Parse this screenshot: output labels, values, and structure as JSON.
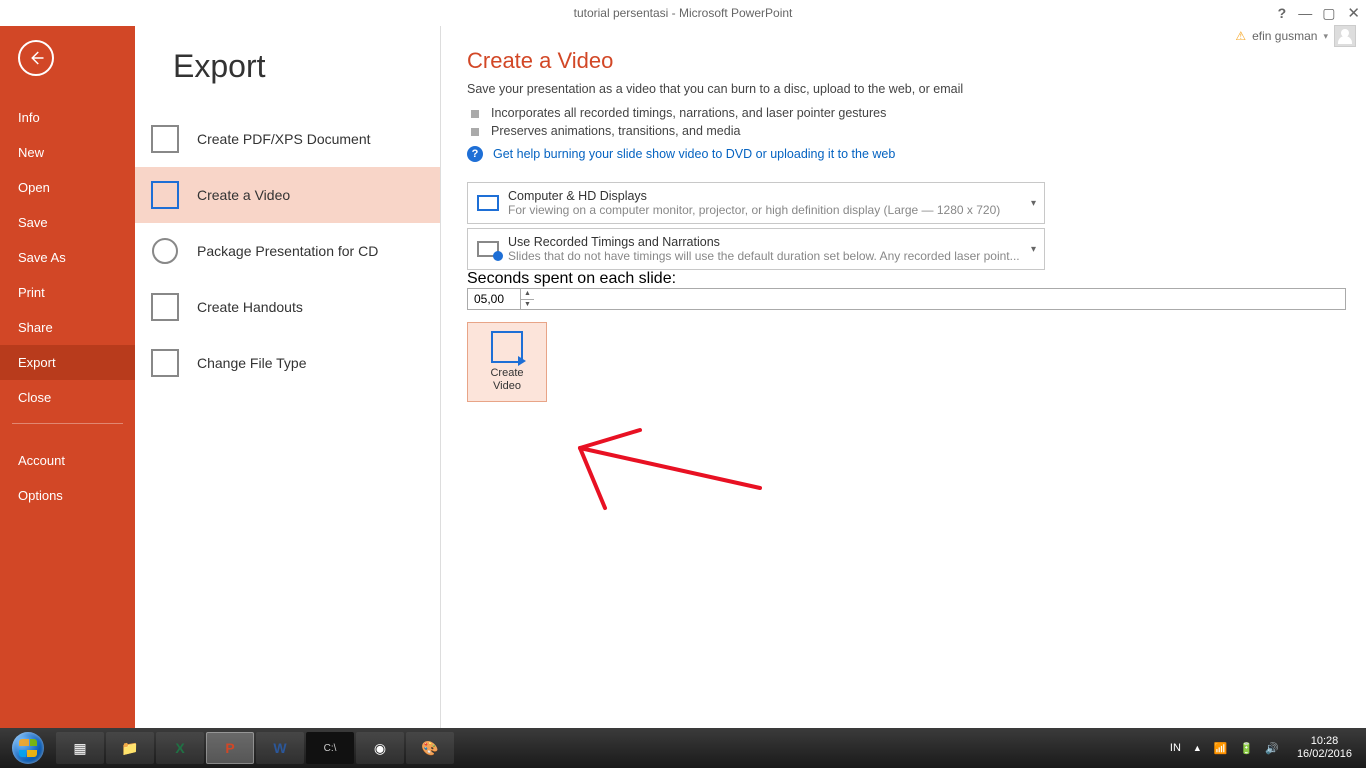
{
  "window": {
    "title": "tutorial persentasi - Microsoft PowerPoint",
    "user": "efin gusman"
  },
  "sidebar": {
    "items": [
      {
        "label": "Info"
      },
      {
        "label": "New"
      },
      {
        "label": "Open"
      },
      {
        "label": "Save"
      },
      {
        "label": "Save As"
      },
      {
        "label": "Print"
      },
      {
        "label": "Share"
      },
      {
        "label": "Export"
      },
      {
        "label": "Close"
      }
    ],
    "footer": [
      {
        "label": "Account"
      },
      {
        "label": "Options"
      }
    ]
  },
  "page": {
    "header": "Export",
    "export_options": [
      {
        "label": "Create PDF/XPS Document"
      },
      {
        "label": "Create a Video"
      },
      {
        "label": "Package Presentation for CD"
      },
      {
        "label": "Create Handouts"
      },
      {
        "label": "Change File Type"
      }
    ]
  },
  "detail": {
    "title": "Create a Video",
    "description": "Save your presentation as a video that you can burn to a disc, upload to the web, or email",
    "bullets": [
      "Incorporates all recorded timings, narrations, and laser pointer gestures",
      "Preserves animations, transitions, and media"
    ],
    "help_link": "Get help burning your slide show video to DVD or uploading it to the web",
    "quality": {
      "title": "Computer & HD Displays",
      "sub": "For viewing on a computer monitor, projector, or high definition display  (Large — 1280 x 720)"
    },
    "timings": {
      "title": "Use Recorded Timings and Narrations",
      "sub": "Slides that do not have timings will use the default duration set below. Any recorded laser point..."
    },
    "seconds_label": "Seconds spent on each slide:",
    "seconds_value": "05,00",
    "create_button": "Create\nVideo"
  },
  "taskbar": {
    "lang": "IN",
    "time": "10:28",
    "date": "16/02/2016"
  }
}
